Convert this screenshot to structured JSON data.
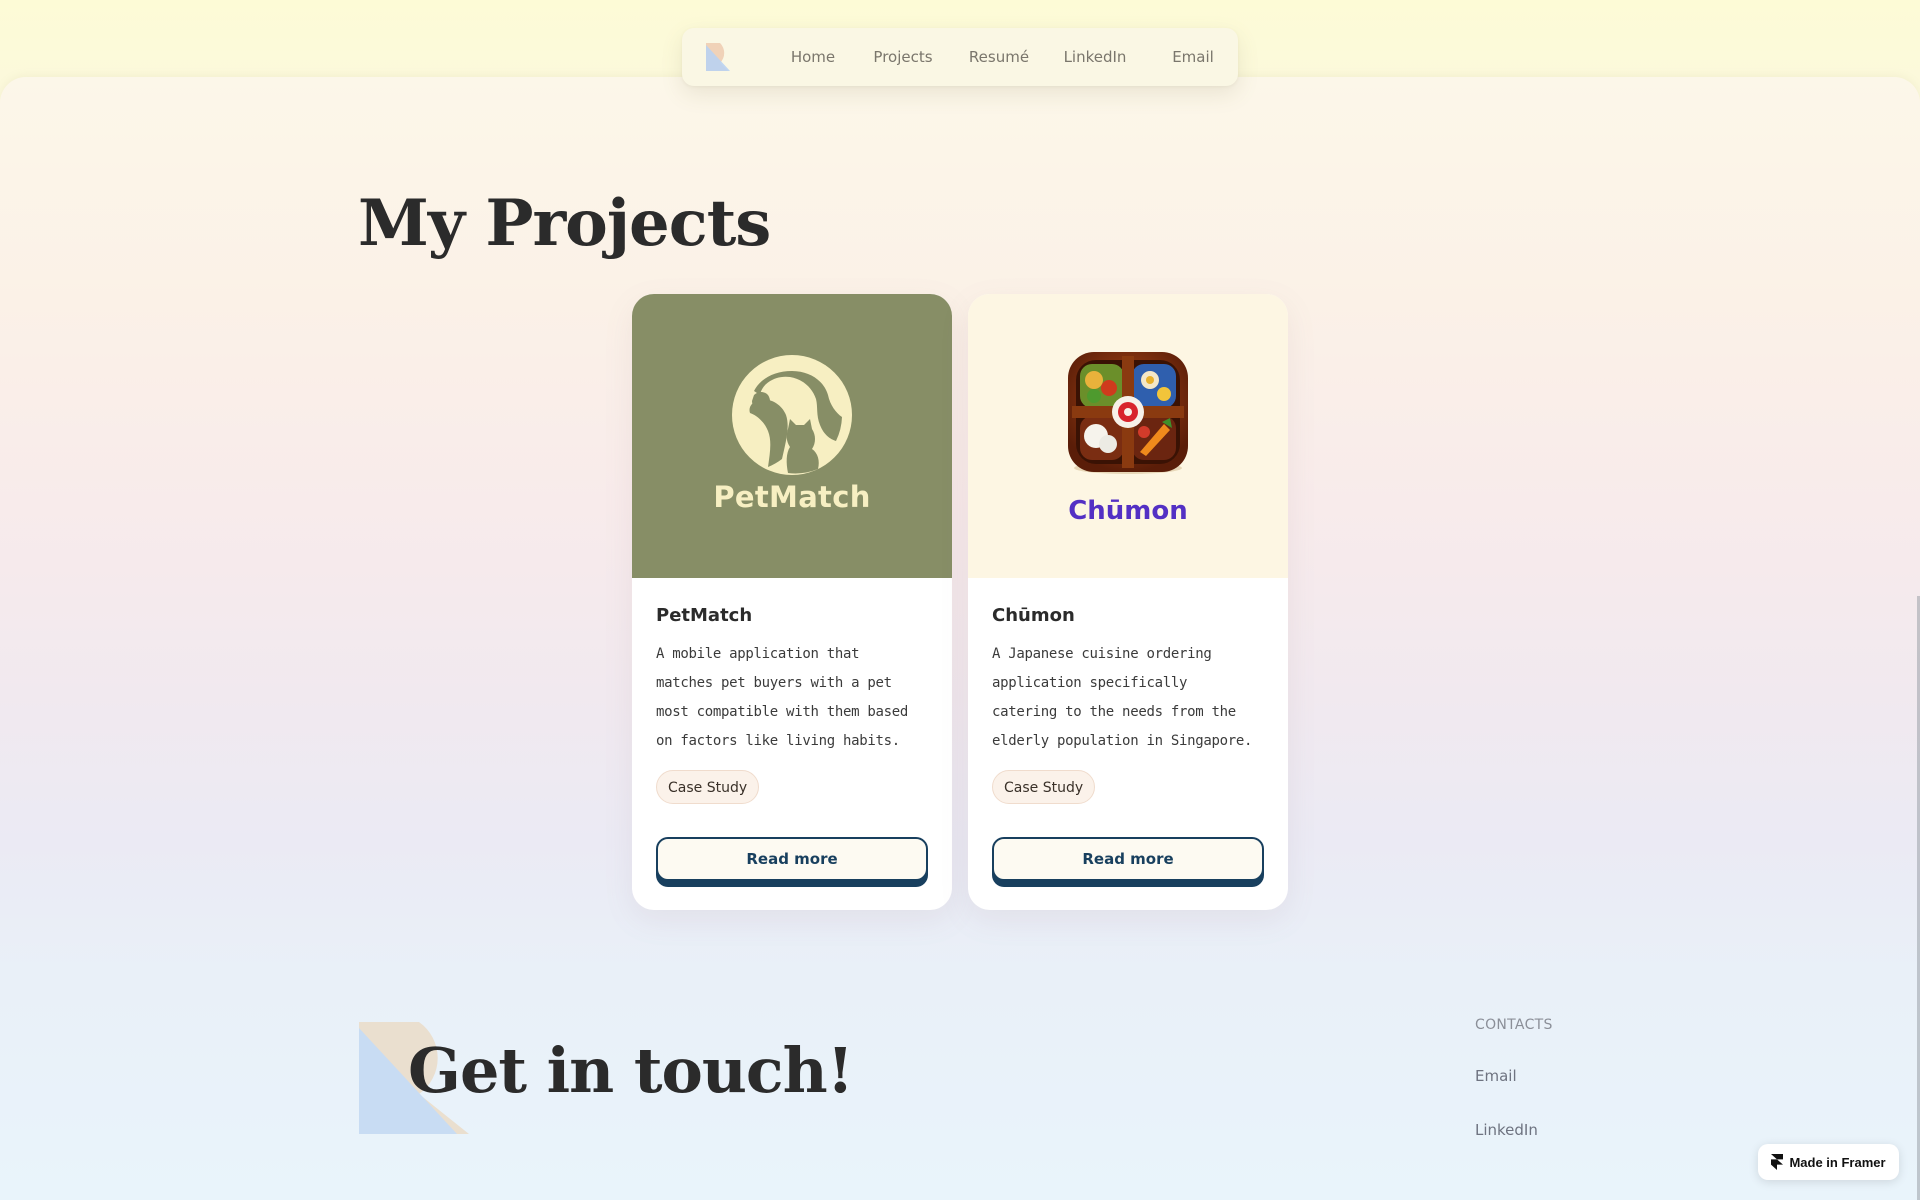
{
  "nav": {
    "items": [
      {
        "label": "Home"
      },
      {
        "label": "Projects"
      },
      {
        "label": "Resumé"
      },
      {
        "label": "LinkedIn"
      },
      {
        "label": "Email"
      }
    ]
  },
  "page": {
    "title": "My Projects"
  },
  "projects": [
    {
      "hero_wordmark": "PetMatch",
      "title": "PetMatch",
      "description": "A mobile application that matches pet buyers with a pet most compatible with them based on factors like living habits.",
      "badge": "Case Study",
      "button": "Read more"
    },
    {
      "hero_wordmark": "Chūmon",
      "title": "Chūmon",
      "description": "A Japanese cuisine ordering application specifically catering to the needs from the elderly population in Singapore.",
      "badge": "Case Study",
      "button": "Read more"
    }
  ],
  "footer": {
    "heading": "Get in touch!",
    "contacts_label": "CONTACTS",
    "links": [
      {
        "label": "Email"
      },
      {
        "label": "LinkedIn"
      }
    ]
  },
  "framer_badge": {
    "label": "Made in Framer"
  },
  "colors": {
    "accent_navy": "#183f5e",
    "petmatch_green": "#878e66",
    "chumon_purple": "#5330c4"
  }
}
